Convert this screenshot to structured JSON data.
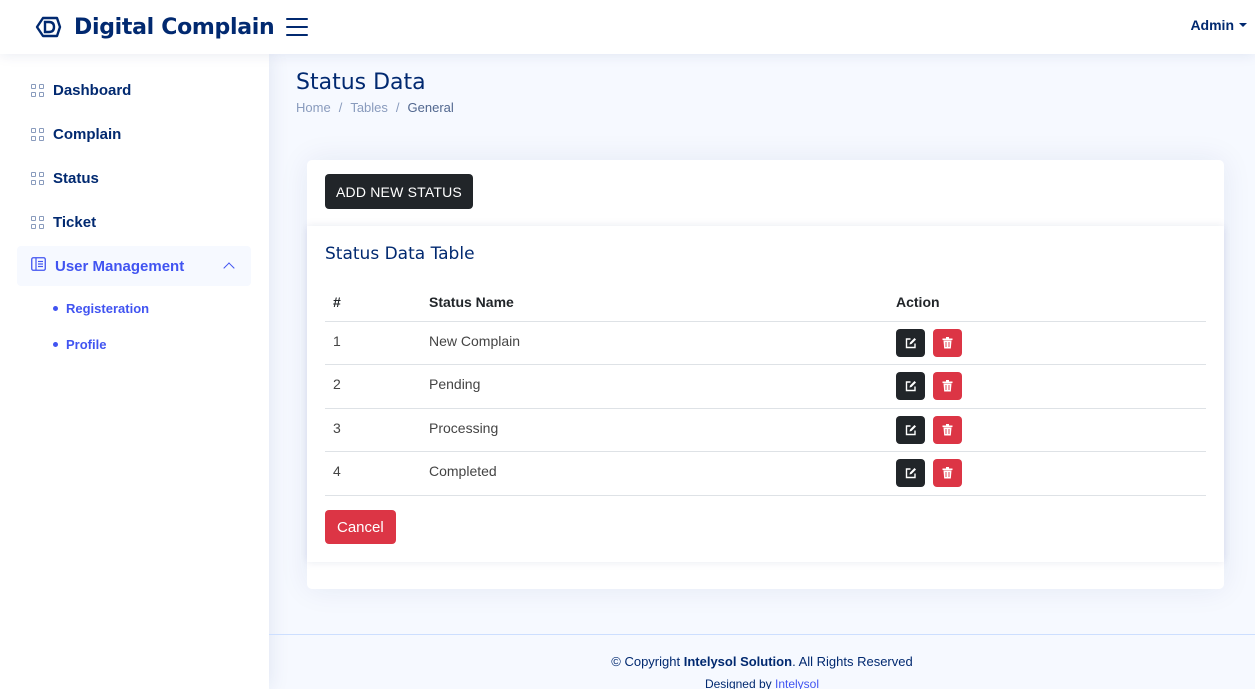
{
  "header": {
    "brand": "Digital Complain",
    "user_menu": "Admin"
  },
  "sidebar": {
    "items": [
      {
        "label": "Dashboard",
        "icon": "grid-icon"
      },
      {
        "label": "Complain",
        "icon": "grid-icon"
      },
      {
        "label": "Status",
        "icon": "grid-icon"
      },
      {
        "label": "Ticket",
        "icon": "grid-icon"
      },
      {
        "label": "User Management",
        "icon": "layout-text-icon",
        "expanded": true
      }
    ],
    "subitems": [
      {
        "label": "Registeration"
      },
      {
        "label": "Profile"
      }
    ]
  },
  "page": {
    "title": "Status Data",
    "breadcrumb": [
      "Home",
      "Tables",
      "General"
    ]
  },
  "card": {
    "add_button": "ADD NEW STATUS",
    "table_title": "Status Data Table",
    "columns": [
      "#",
      "Status Name",
      "Action"
    ],
    "rows": [
      {
        "id": "1",
        "name": "New Complain"
      },
      {
        "id": "2",
        "name": "Pending"
      },
      {
        "id": "3",
        "name": "Processing"
      },
      {
        "id": "4",
        "name": "Completed"
      }
    ],
    "cancel_button": "Cancel"
  },
  "footer": {
    "copy_prefix": "© Copyright ",
    "company": "Intelysol Solution",
    "copy_suffix": ". All Rights Reserved",
    "designed_prefix": "Designed by ",
    "designed_link": "Intelysol"
  },
  "colors": {
    "primary": "#4154f1",
    "navy": "#012970",
    "dark_button": "#212529",
    "danger": "#dc3545",
    "background": "#f6f9ff"
  }
}
